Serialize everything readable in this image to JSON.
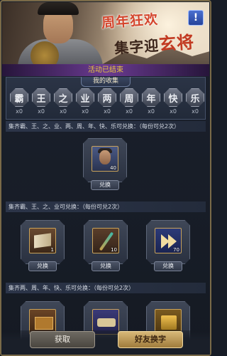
{
  "banner": {
    "title_line1": "周年狂欢",
    "title_line2_a": "集字迎",
    "title_line2_b": "玄将",
    "info_icon": "!",
    "status": "活动已结束"
  },
  "collection": {
    "label": "我的收集",
    "chars": [
      {
        "char": "霸",
        "count": "x0"
      },
      {
        "char": "王",
        "count": "x0"
      },
      {
        "char": "之",
        "count": "x0"
      },
      {
        "char": "业",
        "count": "x0"
      },
      {
        "char": "两",
        "count": "x0"
      },
      {
        "char": "周",
        "count": "x0"
      },
      {
        "char": "年",
        "count": "x0"
      },
      {
        "char": "快",
        "count": "x0"
      },
      {
        "char": "乐",
        "count": "x0"
      }
    ]
  },
  "sections": [
    {
      "title": "集齐霸、王、之、业、两、周、年、快、乐可兑换：（每份可兑2次）",
      "items": [
        {
          "icon": "hero-portrait-icon",
          "qty": "40",
          "button": "兑换"
        }
      ]
    },
    {
      "title": "集齐霸、王、之、业可兑换：（每份可兑2次）",
      "items": [
        {
          "icon": "book-icon",
          "qty": "1",
          "button": "兑换"
        },
        {
          "icon": "staff-icon",
          "qty": "10",
          "button": "兑换"
        },
        {
          "icon": "arrow-icon",
          "qty": "70",
          "button": "兑换"
        }
      ]
    },
    {
      "title": "集齐两、周、年、快、乐可兑换：（每份可兑2次）",
      "items": [
        {
          "icon": "chest-icon",
          "qty": ""
        },
        {
          "icon": "scroll-icon",
          "qty": ""
        },
        {
          "icon": "gold-icon",
          "qty": ""
        }
      ]
    }
  ],
  "footer": {
    "get_button": "获取",
    "swap_button": "好友换字"
  }
}
